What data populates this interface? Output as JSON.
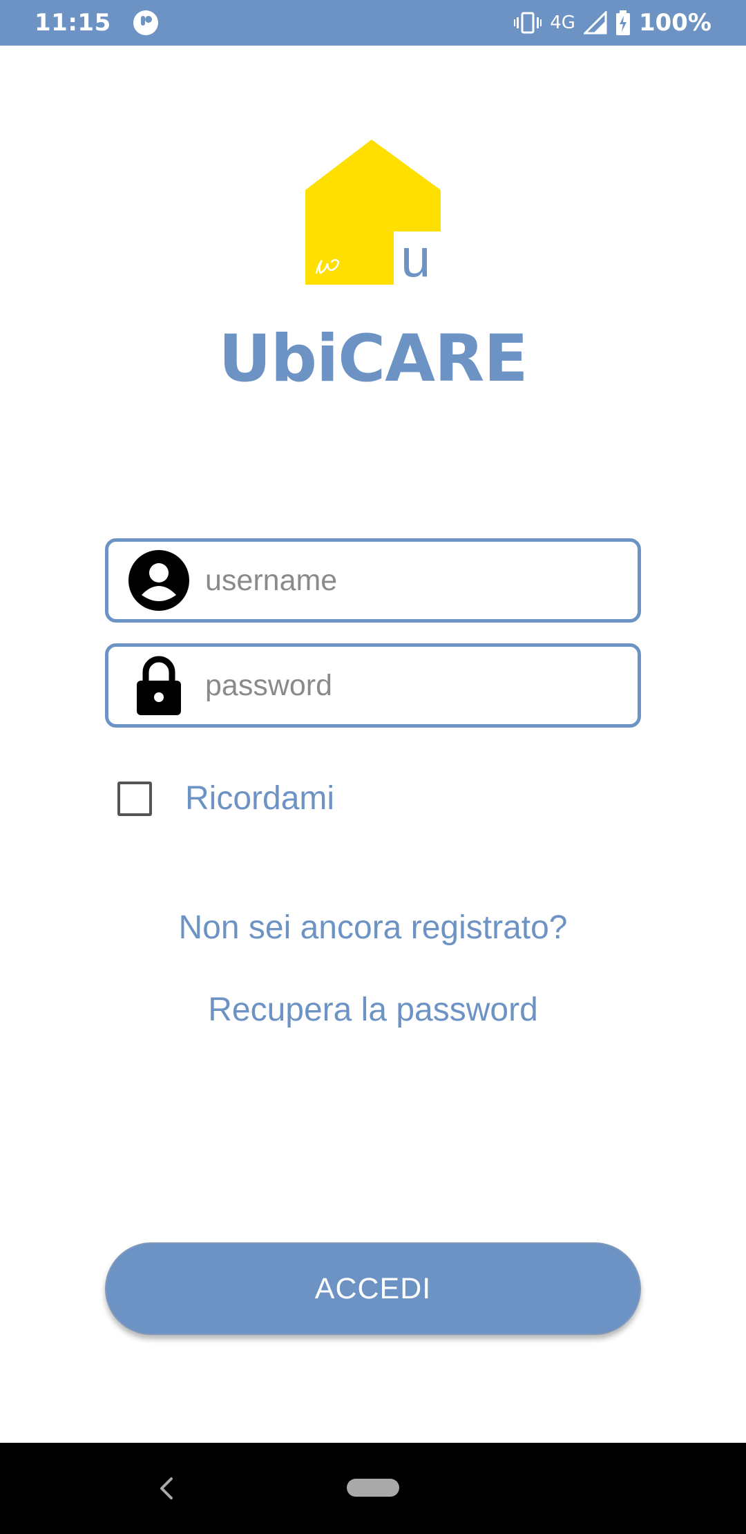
{
  "status_bar": {
    "time": "11:15",
    "network": "4G",
    "battery": "100%",
    "icons": [
      "app-notification-icon",
      "vibrate-icon",
      "signal-icon",
      "battery-charging-icon"
    ]
  },
  "logo": {
    "house_color": "#ffdf00",
    "letter": "u",
    "script_mark": "u"
  },
  "app": {
    "title": "UbiCARE",
    "accent": "#6c93c4"
  },
  "form": {
    "username_placeholder": "username",
    "username_value": "",
    "password_placeholder": "password",
    "password_value": "",
    "remember_label": "Ricordami",
    "remember_checked": false
  },
  "links": {
    "register": "Non sei ancora registrato?",
    "recover": "Recupera la password"
  },
  "actions": {
    "login_label": "ACCEDI"
  },
  "nav": {
    "icons": [
      "back-icon",
      "home-pill-icon"
    ]
  }
}
